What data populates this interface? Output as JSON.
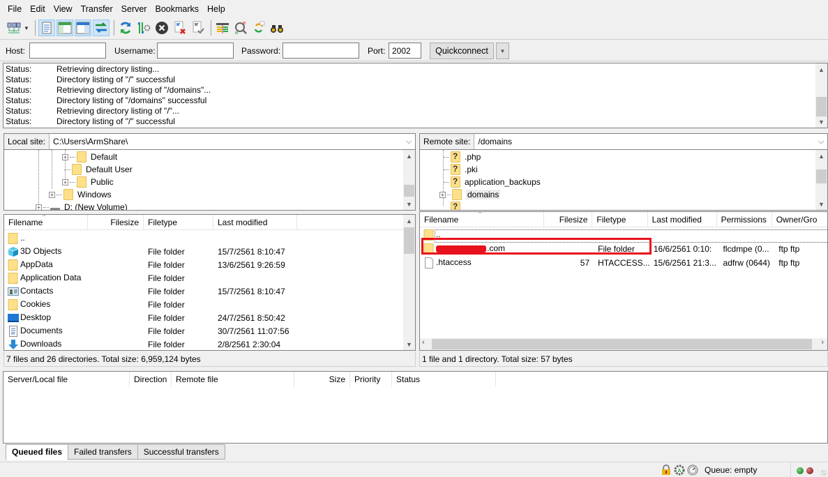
{
  "menu": [
    "File",
    "Edit",
    "View",
    "Transfer",
    "Server",
    "Bookmarks",
    "Help"
  ],
  "toolbar": {
    "buttons": [
      {
        "name": "site-manager",
        "pressed": false
      },
      {
        "name": "toggle-message-log",
        "pressed": true
      },
      {
        "name": "toggle-local-tree",
        "pressed": true
      },
      {
        "name": "toggle-remote-tree",
        "pressed": true
      },
      {
        "name": "toggle-transfer-queue",
        "pressed": true
      },
      {
        "name": "refresh",
        "pressed": false
      },
      {
        "name": "process-queue",
        "pressed": false
      },
      {
        "name": "cancel-operation",
        "pressed": false
      },
      {
        "name": "disconnect",
        "pressed": false
      },
      {
        "name": "reconnect",
        "pressed": false
      },
      {
        "name": "directory-filters",
        "pressed": false
      },
      {
        "name": "directory-comparison",
        "pressed": false
      },
      {
        "name": "sync-browsing",
        "pressed": false
      },
      {
        "name": "search-remote-files",
        "pressed": false
      }
    ]
  },
  "quickconnect": {
    "host_label": "Host:",
    "host_value": "",
    "username_label": "Username:",
    "username_value": "",
    "password_label": "Password:",
    "password_value": "",
    "port_label": "Port:",
    "port_value": "2002",
    "button_label": "Quickconnect"
  },
  "log": [
    {
      "k": "Status:",
      "v": "Retrieving directory listing..."
    },
    {
      "k": "Status:",
      "v": "Directory listing of \"/\" successful"
    },
    {
      "k": "Status:",
      "v": "Retrieving directory listing of \"/domains\"..."
    },
    {
      "k": "Status:",
      "v": "Directory listing of \"/domains\" successful"
    },
    {
      "k": "Status:",
      "v": "Retrieving directory listing of \"/\"..."
    },
    {
      "k": "Status:",
      "v": "Directory listing of \"/\" successful"
    }
  ],
  "local": {
    "site_label": "Local site:",
    "path": "C:\\Users\\ArmShare\\",
    "tree": [
      {
        "label": "Default",
        "expandable": true
      },
      {
        "label": "Default User",
        "expandable": false
      },
      {
        "label": "Public",
        "expandable": true
      },
      {
        "label": "Windows",
        "expandable": true
      },
      {
        "label": "D: (New Volume)",
        "expandable": true
      }
    ],
    "columns": [
      "Filename",
      "Filesize",
      "Filetype",
      "Last modified"
    ],
    "files": [
      {
        "name": "..",
        "size": "",
        "type": "",
        "modified": "",
        "icon": "folder"
      },
      {
        "name": "3D Objects",
        "size": "",
        "type": "File folder",
        "modified": "15/7/2561 8:10:47",
        "icon": "3d"
      },
      {
        "name": "AppData",
        "size": "",
        "type": "File folder",
        "modified": "13/6/2561 9:26:59",
        "icon": "folder"
      },
      {
        "name": "Application Data",
        "size": "",
        "type": "File folder",
        "modified": "",
        "icon": "folder"
      },
      {
        "name": "Contacts",
        "size": "",
        "type": "File folder",
        "modified": "15/7/2561 8:10:47",
        "icon": "contacts"
      },
      {
        "name": "Cookies",
        "size": "",
        "type": "File folder",
        "modified": "",
        "icon": "folder"
      },
      {
        "name": "Desktop",
        "size": "",
        "type": "File folder",
        "modified": "24/7/2561 8:50:42",
        "icon": "desktop"
      },
      {
        "name": "Documents",
        "size": "",
        "type": "File folder",
        "modified": "30/7/2561 11:07:56",
        "icon": "documents"
      },
      {
        "name": "Downloads",
        "size": "",
        "type": "File folder",
        "modified": "2/8/2561 2:30:04",
        "icon": "downloads"
      }
    ],
    "status": "7 files and 26 directories. Total size: 6,959,124 bytes"
  },
  "remote": {
    "site_label": "Remote site:",
    "path": "/domains",
    "tree": [
      {
        "label": ".php",
        "unknown": true
      },
      {
        "label": ".pki",
        "unknown": true
      },
      {
        "label": "application_backups",
        "unknown": true
      },
      {
        "label": "domains",
        "unknown": false,
        "expandable": true,
        "selected": true
      }
    ],
    "columns": [
      "Filename",
      "Filesize",
      "Filetype",
      "Last modified",
      "Permissions",
      "Owner/Gro"
    ],
    "files": [
      {
        "name": "..",
        "size": "",
        "type": "",
        "modified": "",
        "perms": "",
        "owner": "",
        "icon": "folder"
      },
      {
        "name": ".com",
        "size": "",
        "type": "File folder",
        "modified": "16/6/2561 0:10:",
        "perms": "flcdmpe (0...",
        "owner": "ftp ftp",
        "icon": "folder",
        "redacted": true,
        "highlighted": true
      },
      {
        "name": ".htaccess",
        "size": "57",
        "type": "HTACCESS...",
        "modified": "15/6/2561 21:3...",
        "perms": "adfrw (0644)",
        "owner": "ftp ftp",
        "icon": "file"
      }
    ],
    "status": "1 file and 1 directory. Total size: 57 bytes"
  },
  "queue": {
    "columns": [
      "Server/Local file",
      "Direction",
      "Remote file",
      "Size",
      "Priority",
      "Status"
    ],
    "tabs": [
      "Queued files",
      "Failed transfers",
      "Successful transfers"
    ],
    "active_tab": 0
  },
  "statusbar": {
    "queue_text": "Queue: empty"
  },
  "colors": {
    "highlight": "#e8121c",
    "folder": "#ffe08a",
    "accent": "#2a8ad4"
  }
}
